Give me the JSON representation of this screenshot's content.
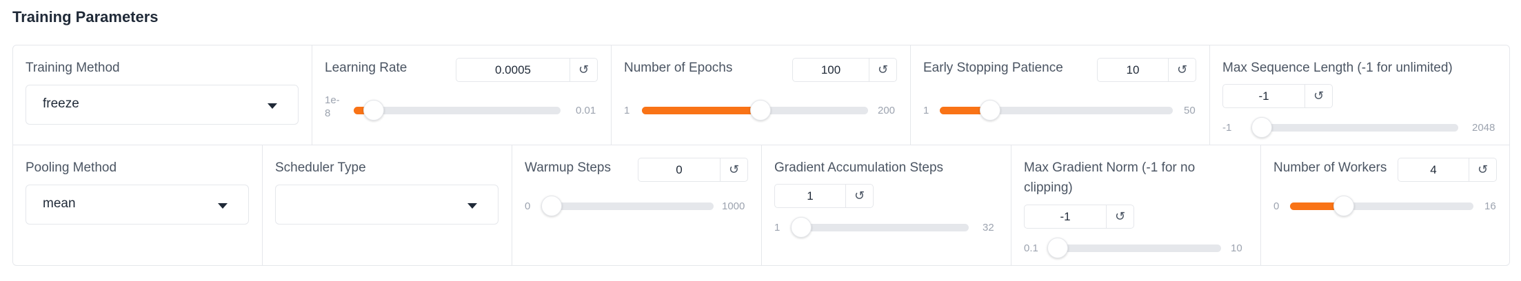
{
  "section_title": "Training Parameters",
  "row1": {
    "training_method": {
      "label": "Training Method",
      "value": "freeze"
    },
    "learning_rate": {
      "label": "Learning Rate",
      "value": "0.0005",
      "min_label": "1e-8",
      "max_label": "0.01",
      "fraction": 0.05
    },
    "num_epochs": {
      "label": "Number of Epochs",
      "value": "100",
      "min_label": "1",
      "max_label": "200",
      "fraction": 0.5
    },
    "early_stopping": {
      "label": "Early Stopping Patience",
      "value": "10",
      "min_label": "1",
      "max_label": "50",
      "fraction": 0.18
    },
    "max_seq_len": {
      "label": "Max Sequence Length (-1 for unlimited)",
      "value": "-1",
      "min_label": "-1",
      "max_label": "2048",
      "fraction": 0.0
    }
  },
  "row2": {
    "pooling_method": {
      "label": "Pooling Method",
      "value": "mean"
    },
    "scheduler_type": {
      "label": "Scheduler Type",
      "value": ""
    },
    "warmup_steps": {
      "label": "Warmup Steps",
      "value": "0",
      "min_label": "0",
      "max_label": "1000",
      "fraction": 0.0
    },
    "grad_accum": {
      "label": "Gradient Accumulation Steps",
      "value": "1",
      "min_label": "1",
      "max_label": "32",
      "fraction": 0.0
    },
    "max_grad_norm": {
      "label": "Max Gradient Norm (-1 for no clipping)",
      "value": "-1",
      "min_label": "0.1",
      "max_label": "10",
      "fraction": 0.0
    },
    "num_workers": {
      "label": "Number of Workers",
      "value": "4",
      "min_label": "0",
      "max_label": "16",
      "fraction": 0.25
    }
  },
  "reset_glyph": "↺",
  "accent_color": "#f97316"
}
